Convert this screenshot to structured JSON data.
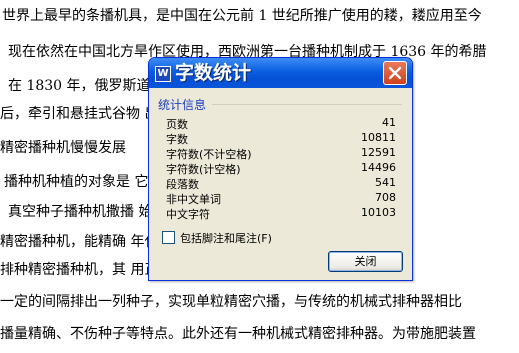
{
  "document": {
    "lines": [
      "世界上最早的条播机具，是中国在公元前 1 世纪所推广使用的耧，耧应用至今",
      "现在依然在中国北方旱作区使用，西欧洲第一台播种机制成于 1636 年的希腊",
      "在 1830 年，俄罗斯道                               ，了犁播机。20 世纪",
      "后，牵引和悬挂式谷物                                  出现。50 年代后",
      "精密播种机慢慢发展",
      "播种机种植的对象是                                    它按播种方式可分",
      "真空种子播种机撒播                                    始大量发展的名",
      "精密播种机，能精确                                    年代开始发展的",
      "排种精密播种机，其                                    用正压或负压气",
      "一定的间隔排出一列种子，实现单粒精密穴播，与传统的机械式排种器相比",
      "播量精确、不伤种子等特点。此外还有一种机械式精密排种器。为带施肥装置"
    ]
  },
  "dialog": {
    "app_icon_letter": "W",
    "title": "字数统计",
    "group_title": "统计信息",
    "stats": [
      {
        "label": "页数",
        "value": "41"
      },
      {
        "label": "字数",
        "value": "10811"
      },
      {
        "label": "字符数(不计空格)",
        "value": "12591"
      },
      {
        "label": "字符数(计空格)",
        "value": "14496"
      },
      {
        "label": "段落数",
        "value": "541"
      },
      {
        "label": "非中文单词",
        "value": "708"
      },
      {
        "label": "中文字符",
        "value": "10103"
      }
    ],
    "checkbox_label": "包括脚注和尾注(F)",
    "close_button_label": "关闭"
  }
}
